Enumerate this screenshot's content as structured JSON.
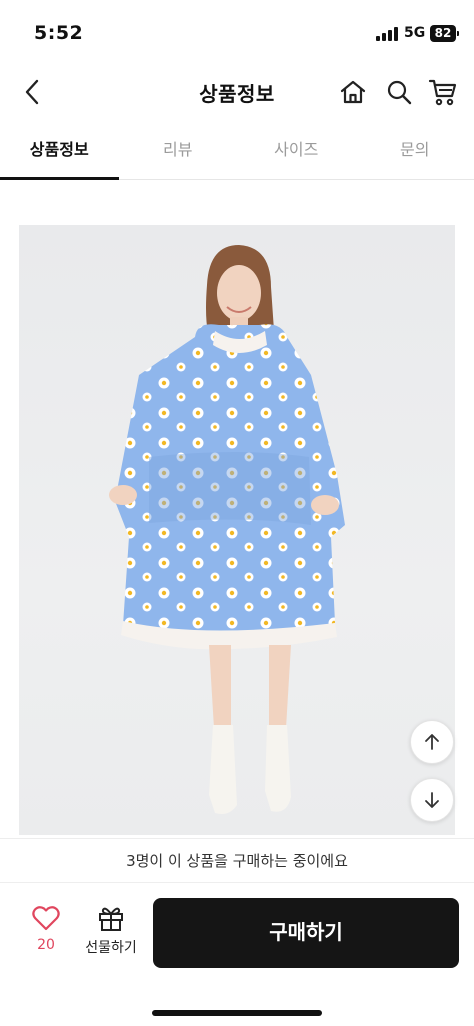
{
  "status_bar": {
    "time": "5:52",
    "network": "5G",
    "battery": "82"
  },
  "header": {
    "title": "상품정보",
    "back_icon": "chevron-left-icon",
    "home_icon": "home-icon",
    "search_icon": "search-icon",
    "cart_icon": "cart-icon"
  },
  "tabs": [
    {
      "label": "상품정보",
      "active": true
    },
    {
      "label": "리뷰",
      "active": false
    },
    {
      "label": "사이즈",
      "active": false
    },
    {
      "label": "문의",
      "active": false
    }
  ],
  "product_image": {
    "description_icon": "product-photo",
    "garment_color": "#8fb6ec"
  },
  "scroll_buttons": {
    "up_icon": "arrow-up-icon",
    "down_icon": "arrow-down-icon"
  },
  "notice": {
    "text": "3명이 이 상품을 구매하는 중이에요"
  },
  "bottom_bar": {
    "like_icon": "heart-icon",
    "like_count": "20",
    "gift_icon": "gift-icon",
    "gift_label": "선물하기",
    "buy_label": "구매하기"
  },
  "colors": {
    "accent": "#151515",
    "like": "#e0465e"
  }
}
